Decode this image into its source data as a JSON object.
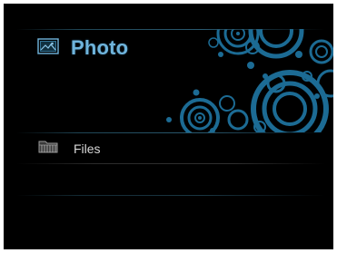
{
  "menu": {
    "photo_label": "Photo",
    "files_label": "Files"
  },
  "icons": {
    "photo": "image-icon",
    "files": "folder-icon"
  },
  "colors": {
    "background": "#000000",
    "accent": "#6fb4dc",
    "decoration": "#1e6a92",
    "label": "#d8d8d8"
  }
}
